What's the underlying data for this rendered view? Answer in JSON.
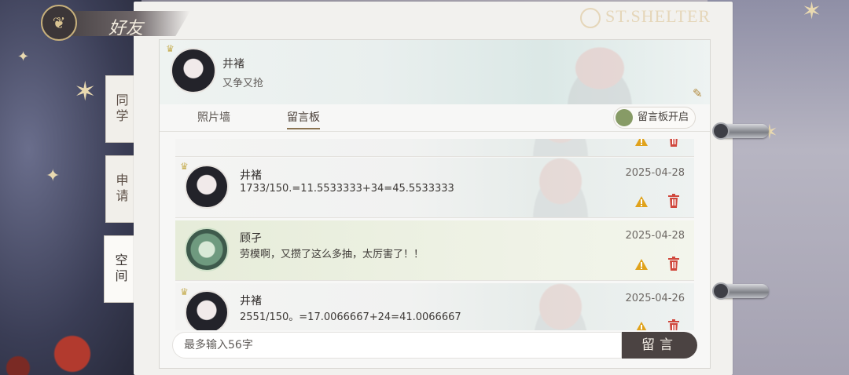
{
  "header": {
    "title": "好友",
    "brand": "ST.SHELTER"
  },
  "side_tabs": [
    {
      "label": "同学",
      "active": false
    },
    {
      "label": "申请",
      "active": false
    },
    {
      "label": "空间",
      "active": true
    }
  ],
  "profile": {
    "name": "井褚",
    "signature": "又争又抢"
  },
  "tabs": [
    {
      "label": "照片墙",
      "active": false
    },
    {
      "label": "留言板",
      "active": true
    }
  ],
  "toggle": {
    "label": "留言板开启",
    "on": true,
    "color": "#879b66"
  },
  "messages": [
    {
      "name": "井褚",
      "text": "1733/150.=11.5533333+34=45.5533333",
      "date": "2025-04-28",
      "highlighted": false
    },
    {
      "name": "顾孑",
      "text": "劳模啊，又攒了这么多抽，太厉害了！！",
      "date": "2025-04-28",
      "highlighted": true
    },
    {
      "name": "井褚",
      "text": "2551/150。=17.0066667+24=41.0066667",
      "date": "2025-04-26",
      "highlighted": false
    }
  ],
  "composer": {
    "placeholder": "最多输入56字",
    "send_label": "留言"
  },
  "icons": {
    "title": "butterfly-icon",
    "edit": "edit-icon",
    "warn": "warning-icon",
    "delete": "trash-icon",
    "brand": "brand-crest-icon"
  },
  "colors": {
    "accent": "#8a7350",
    "send_button": "#4b4342",
    "delete": "#d0473c",
    "warn": "#e0a21b"
  }
}
